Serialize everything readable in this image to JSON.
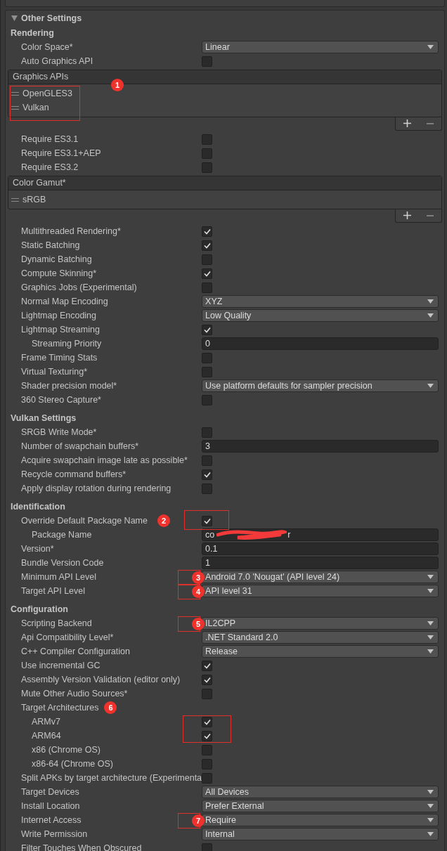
{
  "panel": {
    "title": "Other Settings",
    "expanded": true
  },
  "sections": [
    {
      "title": "Rendering",
      "rows": [
        {
          "kind": "dropdown",
          "label": "Color Space*",
          "value": "Linear"
        },
        {
          "kind": "checkbox",
          "label": "Auto Graphics API",
          "checked": false
        },
        {
          "kind": "list",
          "title": "Graphics APIs",
          "items": [
            "OpenGLES3",
            "Vulkan"
          ],
          "marker": "1"
        },
        {
          "kind": "checkbox",
          "label": "Require ES3.1",
          "checked": false
        },
        {
          "kind": "checkbox",
          "label": "Require ES3.1+AEP",
          "checked": false
        },
        {
          "kind": "checkbox",
          "label": "Require ES3.2",
          "checked": false
        },
        {
          "kind": "list",
          "title": "Color Gamut*",
          "items": [
            "sRGB"
          ]
        },
        {
          "kind": "checkbox",
          "label": "Multithreaded Rendering*",
          "checked": true
        },
        {
          "kind": "checkbox",
          "label": "Static Batching",
          "checked": true
        },
        {
          "kind": "checkbox",
          "label": "Dynamic Batching",
          "checked": false
        },
        {
          "kind": "checkbox",
          "label": "Compute Skinning*",
          "checked": true
        },
        {
          "kind": "checkbox",
          "label": "Graphics Jobs (Experimental)",
          "checked": false
        },
        {
          "kind": "dropdown",
          "label": "Normal Map Encoding",
          "value": "XYZ"
        },
        {
          "kind": "dropdown",
          "label": "Lightmap Encoding",
          "value": "Low Quality"
        },
        {
          "kind": "checkbox",
          "label": "Lightmap Streaming",
          "checked": true,
          "children": [
            {
              "kind": "field",
              "label": "Streaming Priority",
              "value": "0"
            }
          ]
        },
        {
          "kind": "checkbox",
          "label": "Frame Timing Stats",
          "checked": false
        },
        {
          "kind": "checkbox",
          "label": "Virtual Texturing*",
          "checked": false
        },
        {
          "kind": "dropdown",
          "label": "Shader precision model*",
          "value": "Use platform defaults for sampler precision"
        },
        {
          "kind": "checkbox",
          "label": "360 Stereo Capture*",
          "checked": false
        }
      ]
    },
    {
      "title": "Vulkan Settings",
      "rows": [
        {
          "kind": "checkbox",
          "label": "SRGB Write Mode*",
          "checked": false
        },
        {
          "kind": "field",
          "label": "Number of swapchain buffers*",
          "value": "3"
        },
        {
          "kind": "checkbox",
          "label": "Acquire swapchain image late as possible*",
          "checked": false
        },
        {
          "kind": "checkbox",
          "label": "Recycle command buffers*",
          "checked": true
        },
        {
          "kind": "checkbox",
          "label": "Apply display rotation during rendering",
          "checked": false
        }
      ]
    },
    {
      "title": "Identification",
      "rows": [
        {
          "kind": "checkbox",
          "label": "Override Default Package Name",
          "checked": true,
          "marker": "2",
          "children": [
            {
              "kind": "redacted",
              "label": "Package Name",
              "value_parts": [
                "co",
                "r"
              ]
            }
          ]
        },
        {
          "kind": "field",
          "label": "Version*",
          "value": "0.1"
        },
        {
          "kind": "field",
          "label": "Bundle Version Code",
          "value": "1"
        },
        {
          "kind": "dropdown",
          "label": "Minimum API Level",
          "value": "Android 7.0 'Nougat' (API level 24)",
          "marker": "3"
        },
        {
          "kind": "dropdown",
          "label": "Target API Level",
          "value": "API level 31",
          "marker": "4"
        }
      ]
    },
    {
      "title": "Configuration",
      "rows": [
        {
          "kind": "dropdown",
          "label": "Scripting Backend",
          "value": "IL2CPP",
          "marker": "5"
        },
        {
          "kind": "dropdown",
          "label": "Api Compatibility Level*",
          "value": ".NET Standard 2.0"
        },
        {
          "kind": "dropdown",
          "label": "C++ Compiler Configuration",
          "value": "Release"
        },
        {
          "kind": "checkbox",
          "label": "Use incremental GC",
          "checked": true
        },
        {
          "kind": "checkbox",
          "label": "Assembly Version Validation (editor only)",
          "checked": true
        },
        {
          "kind": "checkbox",
          "label": "Mute Other Audio Sources*",
          "checked": false
        },
        {
          "kind": "text",
          "label": "Target Architectures",
          "marker": "6",
          "children": [
            {
              "kind": "checkbox",
              "label": "ARMv7",
              "checked": true
            },
            {
              "kind": "checkbox",
              "label": "ARM64",
              "checked": true
            },
            {
              "kind": "checkbox",
              "label": "x86 (Chrome OS)",
              "checked": false
            },
            {
              "kind": "checkbox",
              "label": "x86-64 (Chrome OS)",
              "checked": false
            }
          ]
        },
        {
          "kind": "checkbox",
          "label": "Split APKs by target architecture (Experimenta",
          "checked": false
        },
        {
          "kind": "dropdown",
          "label": "Target Devices",
          "value": "All Devices"
        },
        {
          "kind": "dropdown",
          "label": "Install Location",
          "value": "Prefer External"
        },
        {
          "kind": "dropdown",
          "label": "Internet Access",
          "value": "Require",
          "marker": "7"
        },
        {
          "kind": "dropdown",
          "label": "Write Permission",
          "value": "Internal"
        },
        {
          "kind": "checkbox",
          "label": "Filter Touches When Obscured",
          "checked": false
        }
      ]
    }
  ]
}
